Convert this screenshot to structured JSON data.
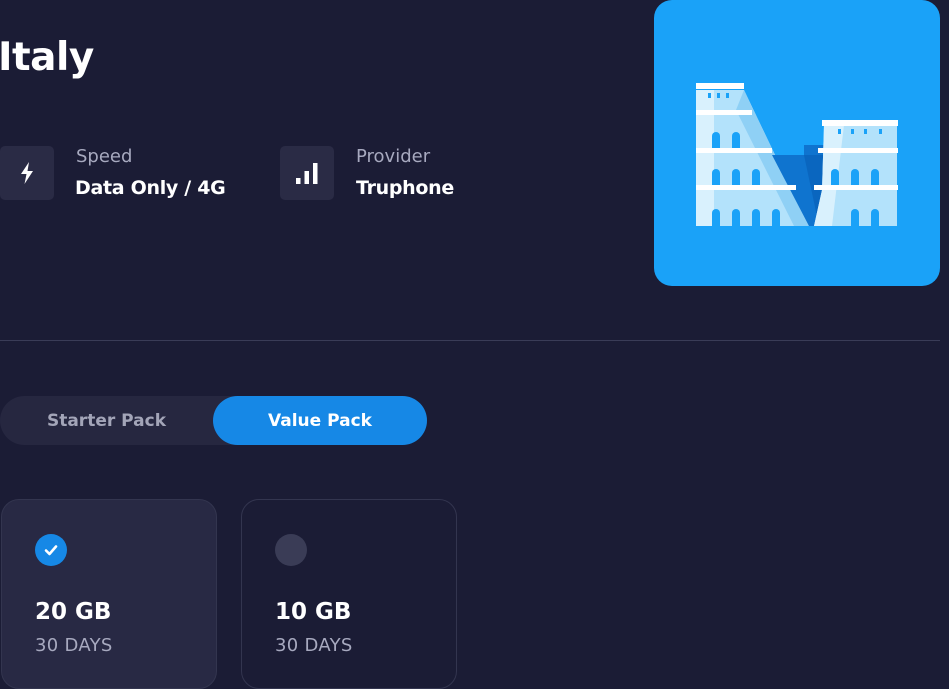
{
  "country": {
    "name": "Italy"
  },
  "info": {
    "speed": {
      "label": "Speed",
      "value": "Data Only / 4G",
      "icon": "lightning-icon"
    },
    "provider": {
      "label": "Provider",
      "value": "Truphone",
      "icon": "signal-bars-icon"
    }
  },
  "hero": {
    "icon": "colosseum-illustration",
    "background_color": "#1aa2f8"
  },
  "packs": {
    "tabs": [
      {
        "label": "Starter Pack",
        "active": false
      },
      {
        "label": "Value Pack",
        "active": true
      }
    ]
  },
  "plans": [
    {
      "size": "20 GB",
      "duration": "30 DAYS",
      "selected": true
    },
    {
      "size": "10 GB",
      "duration": "30 DAYS",
      "selected": false
    }
  ],
  "colors": {
    "background": "#1b1c35",
    "accent": "#1688e6",
    "card": "#282944"
  }
}
